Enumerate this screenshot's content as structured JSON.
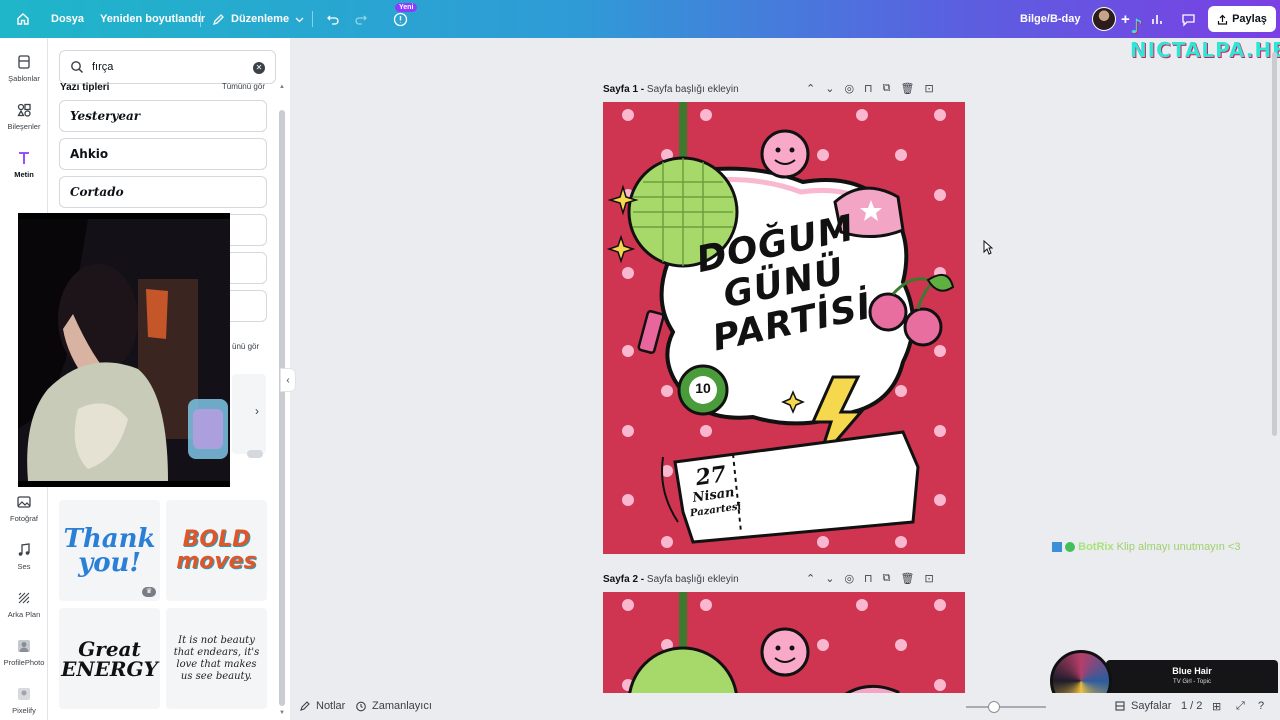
{
  "topbar": {
    "home_icon": "home-icon",
    "file_label": "Dosya",
    "resize_label": "Yeniden boyutlandır",
    "edit_label": "Düzenleme",
    "new_badge": "Yeni",
    "doc_title": "Bilge/B-day",
    "share_label": "Paylaş",
    "overlay_watermark": "NICTALPA.HER"
  },
  "rail": {
    "items": [
      {
        "label": "Şablonlar",
        "icon": "templates-icon"
      },
      {
        "label": "Bileşenler",
        "icon": "elements-icon"
      },
      {
        "label": "Metin",
        "icon": "text-icon"
      },
      {
        "label": "Fotoğraf",
        "icon": "photo-icon"
      },
      {
        "label": "Ses",
        "icon": "music-icon"
      },
      {
        "label": "Arka Plan",
        "icon": "background-icon"
      },
      {
        "label": "ProfilePhoto",
        "icon": "profile-photo-icon"
      },
      {
        "label": "Pixelify",
        "icon": "pixelify-icon"
      }
    ]
  },
  "panel": {
    "search_value": "fırça",
    "section_title": "Yazı tipleri",
    "see_all": "Tümünü gör",
    "see_all_2": "ünü gör",
    "fonts": [
      "Yesteryear",
      "Ahkio",
      "Cortado"
    ],
    "tiles": [
      {
        "text": "Thank you!",
        "color": "#2a7fd6"
      },
      {
        "text": "BOLD moves",
        "color": "#e0552a"
      },
      {
        "text": "Great ENERGY",
        "color": "#111111"
      },
      {
        "text": "It is not beauty that endears, it's love that makes us see beauty.",
        "color": "#222222"
      }
    ]
  },
  "canvas": {
    "page1_number": "Sayfa 1 -",
    "page1_title_placeholder": "Sayfa başlığı ekleyin",
    "page2_number": "Sayfa 2 -",
    "page2_title_placeholder": "Sayfa başlığı ekleyin",
    "design_title": [
      "DOĞUM",
      "GÜNÜ",
      "PARTİSİ"
    ],
    "ball_number": "10",
    "ticket_day": "27",
    "ticket_month": "Nisan",
    "ticket_weekday": "Pazartesi",
    "background_color": "#cf3550"
  },
  "chat": {
    "user": "BotRix",
    "message": "Klip almayı unutmayın <3"
  },
  "music": {
    "title": "Blue Hair",
    "artist": "TV Girl - Topic"
  },
  "bottombar": {
    "notes_label": "Notlar",
    "timer_label": "Zamanlayıcı",
    "pages_label": "Sayfalar",
    "page_counter": "1 / 2",
    "zoom_level": 0.35
  }
}
